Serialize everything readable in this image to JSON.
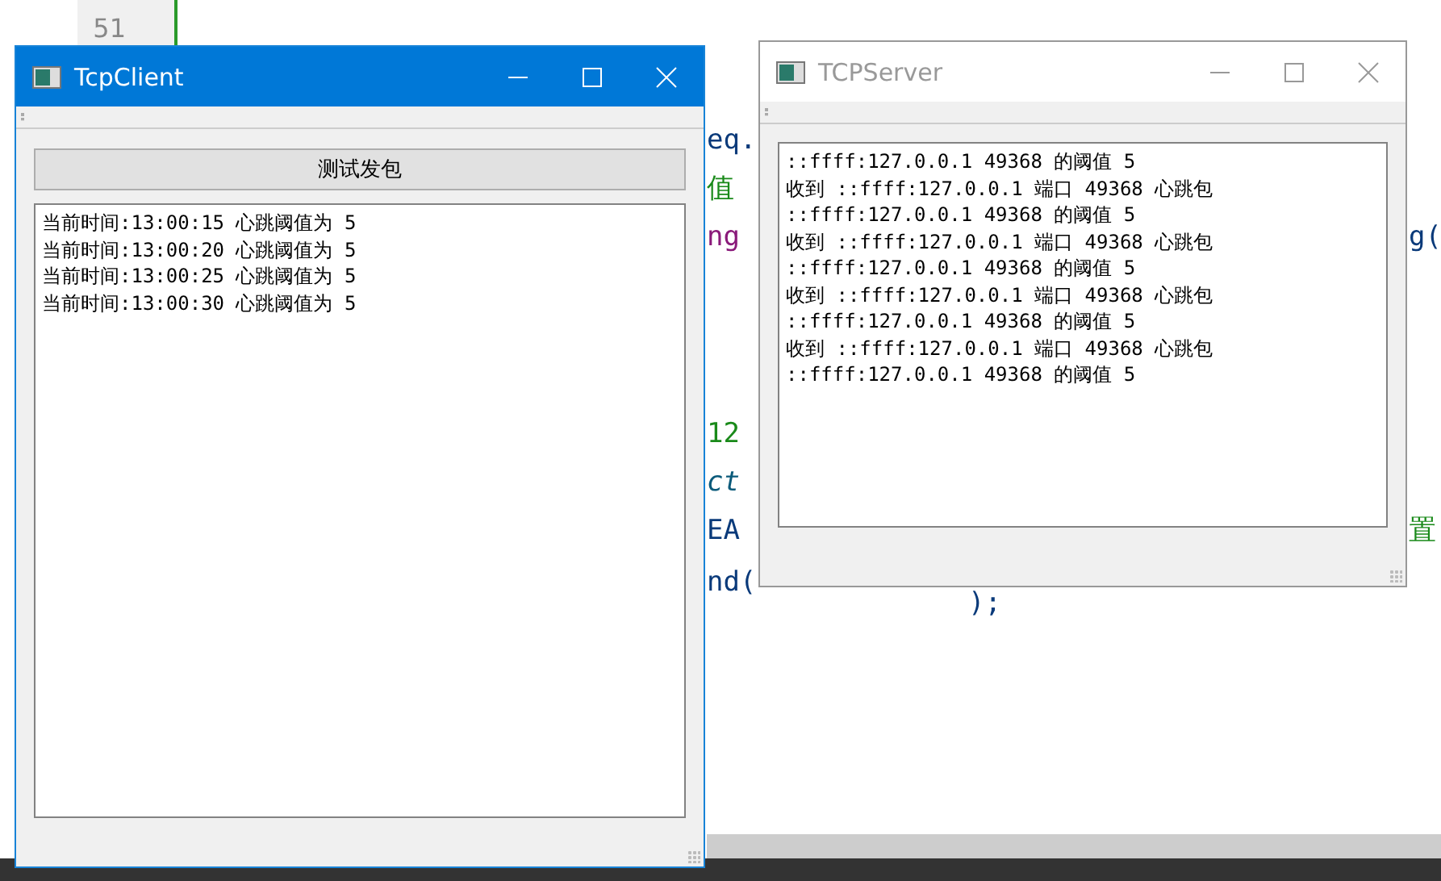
{
  "editor": {
    "line_numbers": [
      "51"
    ],
    "code_fragments": [
      {
        "text": "eq.",
        "kind": "plain"
      },
      {
        "text": "值",
        "kind": "string"
      },
      {
        "text": "ng",
        "kind": "function"
      },
      {
        "text": "g(",
        "kind": "plain"
      },
      {
        "text": "12",
        "kind": "string"
      },
      {
        "text": "ct",
        "kind": "italic"
      },
      {
        "text": "EA",
        "kind": "plain"
      },
      {
        "text": "置",
        "kind": "string"
      },
      {
        "text": "nd(",
        "kind": "plain"
      },
      {
        "text": ");",
        "kind": "plain"
      }
    ]
  },
  "client_window": {
    "title": "TcpClient",
    "active": true,
    "button": "测试发包",
    "log": [
      "当前时间:13:00:15 心跳阈值为 5",
      "当前时间:13:00:20 心跳阈值为 5",
      "当前时间:13:00:25 心跳阈值为 5",
      "当前时间:13:00:30 心跳阈值为 5"
    ]
  },
  "server_window": {
    "title": "TCPServer",
    "active": false,
    "log": [
      "::ffff:127.0.0.1 49368 的阈值 5",
      "收到 ::ffff:127.0.0.1 端口 49368 心跳包",
      "::ffff:127.0.0.1 49368 的阈值 5",
      "收到 ::ffff:127.0.0.1 端口 49368 心跳包",
      "::ffff:127.0.0.1 49368 的阈值 5",
      "收到 ::ffff:127.0.0.1 端口 49368 心跳包",
      "::ffff:127.0.0.1 49368 的阈值 5",
      "收到 ::ffff:127.0.0.1 端口 49368 心跳包",
      "::ffff:127.0.0.1 49368 的阈值 5"
    ]
  }
}
